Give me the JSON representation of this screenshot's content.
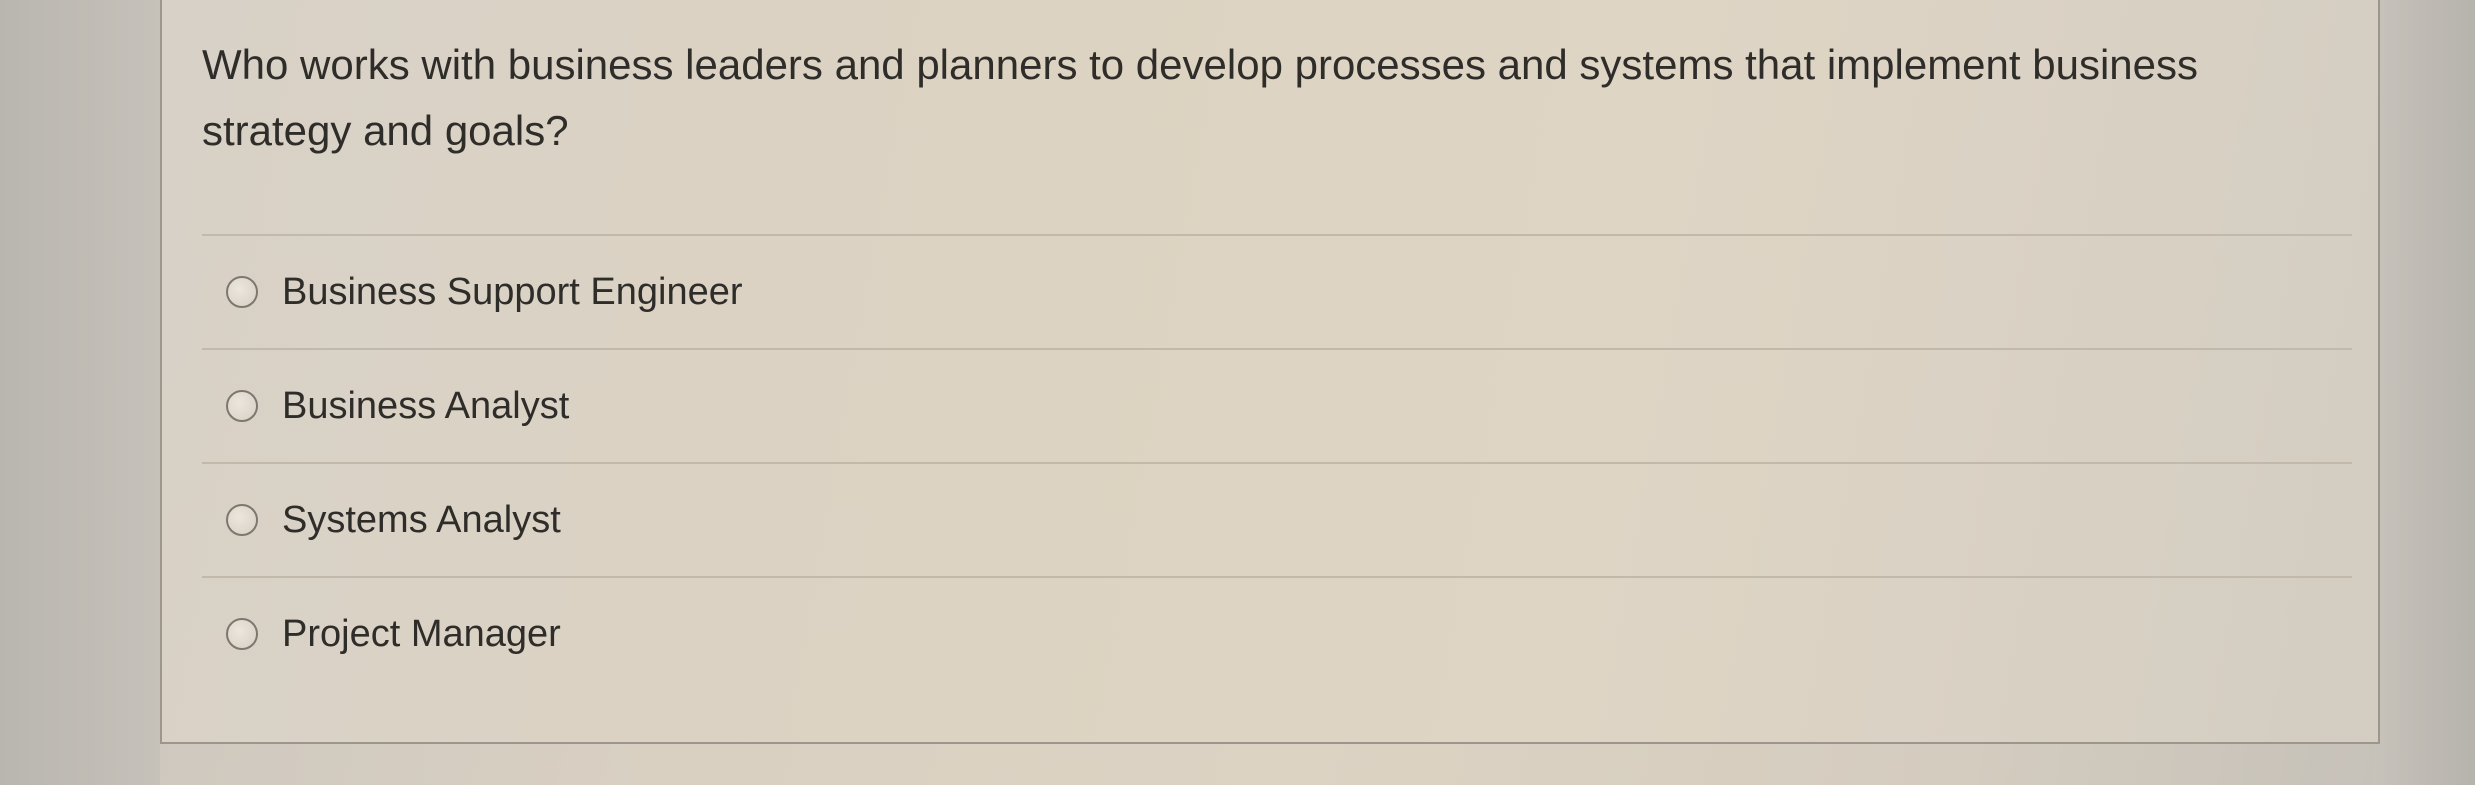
{
  "question": {
    "text": "Who works with business leaders and planners to develop processes and systems that implement business strategy and goals?"
  },
  "options": [
    {
      "label": "Business Support Engineer",
      "selected": false
    },
    {
      "label": "Business Analyst",
      "selected": false
    },
    {
      "label": "Systems Analyst",
      "selected": false
    },
    {
      "label": "Project Manager",
      "selected": false
    }
  ]
}
